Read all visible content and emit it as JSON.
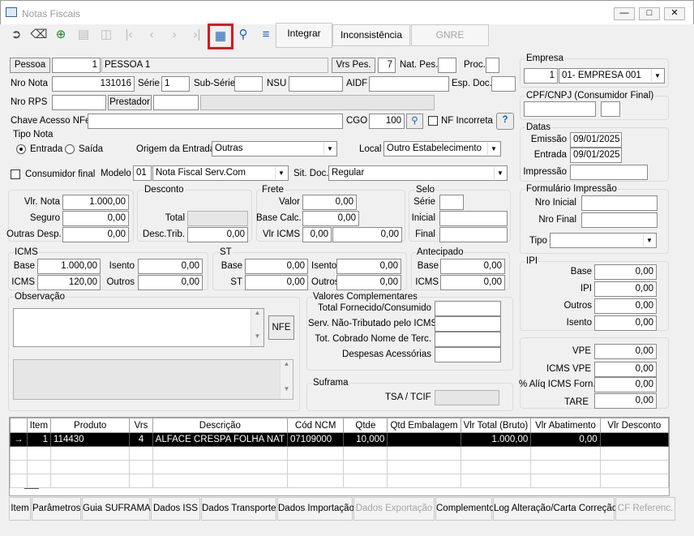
{
  "window": {
    "title": "Notas Fiscais"
  },
  "toolbar": {
    "integrar": "Integrar",
    "inconsistencia": "Inconsistência",
    "gnre": "GNRE"
  },
  "pessoa": {
    "btn": "Pessoa",
    "codigo": "1",
    "nome": "PESSOA 1",
    "vrs_btn": "Vrs Pes.",
    "vrs": "7",
    "nat_label": "Nat. Pes.",
    "nat": "",
    "proc_label": "Proc.",
    "proc": ""
  },
  "nota": {
    "nro_label": "Nro Nota",
    "nro": "131016",
    "serie_label": "Série",
    "serie": "1",
    "subserie_label": "Sub-Série",
    "subserie": "",
    "nsu_label": "NSU",
    "nsu": "",
    "aidf_label": "AIDF",
    "aidf": "",
    "esp_label": "Esp. Doc.",
    "esp": ""
  },
  "rps": {
    "label": "Nro RPS",
    "value": "",
    "prestador_btn": "Prestador",
    "prestador": ""
  },
  "chave": {
    "label": "Chave Acesso NFe",
    "value": "",
    "cgo_label": "CGO",
    "cgo": "100",
    "nf_incorreta": "NF Incorreta"
  },
  "tipo_nota": {
    "title": "Tipo Nota",
    "entrada": "Entrada",
    "saida": "Saída",
    "origem_label": "Origem da Entrada",
    "origem": "Outras",
    "local_label": "Local",
    "local": "Outro Estabelecimento"
  },
  "consumidor": {
    "label": "Consumidor final",
    "modelo_label": "Modelo",
    "modelo_cod": "01",
    "modelo": "Nota Fiscal Serv.Com",
    "sitdoc_label": "Sit. Doc.",
    "sitdoc": "Regular"
  },
  "valores": {
    "vlr_nota_label": "Vlr. Nota",
    "vlr_nota": "1.000,00",
    "seguro_label": "Seguro",
    "seguro": "0,00",
    "outras_label": "Outras Desp.",
    "outras": "0,00"
  },
  "desconto": {
    "title": "Desconto",
    "total_label": "Total",
    "total": "",
    "desc_trib_label": "Desc.Trib.",
    "desc_trib": "0,00"
  },
  "frete": {
    "title": "Frete",
    "valor_label": "Valor",
    "valor": "0,00",
    "base_label": "Base Calc.",
    "base": "0,00",
    "icms_label": "Vlr ICMS",
    "icms_a": "0,00",
    "icms_b": "0,00"
  },
  "selo": {
    "title": "Selo",
    "serie_label": "Série",
    "serie": "",
    "inicial_label": "Inicial",
    "inicial": "",
    "final_label": "Final",
    "final": ""
  },
  "icms": {
    "title": "ICMS",
    "base_label": "Base",
    "base": "1.000,00",
    "icms_label": "ICMS",
    "icms": "120,00",
    "isento_label": "Isento",
    "isento": "0,00",
    "outros_label": "Outros",
    "outros": "0,00"
  },
  "st": {
    "title": "ST",
    "base_label": "Base",
    "base": "0,00",
    "st_label": "ST",
    "st": "0,00",
    "isento_label": "Isento",
    "isento": "0,00",
    "outros_label": "Outros",
    "outros": "0,00"
  },
  "antecipado": {
    "title": "Antecipado",
    "base_label": "Base",
    "base": "0,00",
    "icms_label": "ICMS",
    "icms": "0,00"
  },
  "observacao": {
    "title": "Observação",
    "nfe_btn": "NFE"
  },
  "complementares": {
    "title": "Valores Complementares",
    "l1": "Total Fornecido/Consumido",
    "l2": "Serv. Não-Tributado pelo ICMS",
    "l3": "Tot. Cobrado Nome de Terc.",
    "l4": "Despesas Acessórias"
  },
  "suframa": {
    "title": "Suframa",
    "tsa_label": "TSA / TCIF"
  },
  "empresa": {
    "title": "Empresa",
    "codigo": "1",
    "nome": "01- EMPRESA 001"
  },
  "cpf": {
    "title": "CPF/CNPJ (Consumidor Final)"
  },
  "datas": {
    "title": "Datas",
    "emissao_label": "Emissão",
    "emissao": "09/01/2025",
    "entrada_label": "Entrada",
    "entrada": "09/01/2025",
    "impressao_label": "Impressão",
    "impressao": ""
  },
  "formulario": {
    "title": "Formulário Impressão",
    "nro_inicial_label": "Nro Inicial",
    "nro_final_label": "Nro Final",
    "tipo_label": "Tipo"
  },
  "ipi": {
    "title": "IPI",
    "base_label": "Base",
    "base": "0,00",
    "ipi_label": "IPI",
    "ipi": "0,00",
    "outros_label": "Outros",
    "outros": "0,00",
    "isento_label": "Isento",
    "isento": "0,00"
  },
  "vpe": {
    "vpe_label": "VPE",
    "vpe": "0,00",
    "icms_vpe_label": "ICMS VPE",
    "icms_vpe": "0,00",
    "aliq_label": "% Alíq ICMS Forn.",
    "aliq": "0,00",
    "tare_label": "TARE",
    "tare": "0,00"
  },
  "grid": {
    "headers": [
      "",
      "Item",
      "Produto",
      "Vrs",
      "Descrição",
      "Cód NCM",
      "Qtde",
      "Qtd Embalagem",
      "Vlr Total (Bruto)",
      "Vlr Abatimento",
      "Vlr Desconto"
    ],
    "rows": [
      [
        "→",
        "1",
        "114430",
        "4",
        "ALFACE CRESPA FOLHA NAT ",
        "07109000",
        "10,000",
        "",
        "1.000,00",
        "0,00",
        ""
      ]
    ]
  },
  "tabs": [
    "Item",
    "Parâmetros",
    "Guia SUFRAMA",
    "Dados ISS",
    "Dados Transporte",
    "Dados Importação",
    "Dados Exportação",
    "Complemento",
    "Log Alteração/Carta Correção",
    "CF Referenc."
  ]
}
